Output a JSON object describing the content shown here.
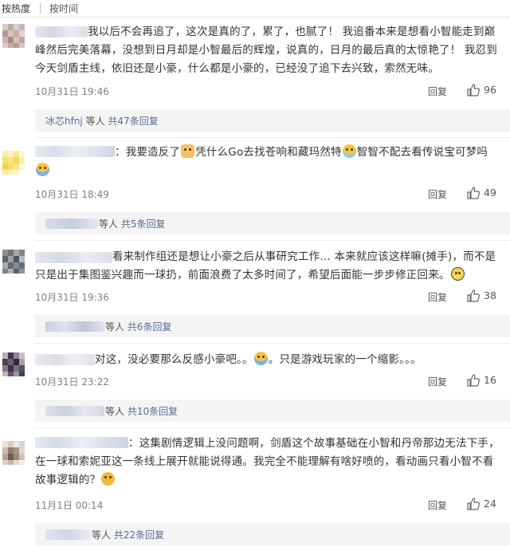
{
  "sort": {
    "hot": "按热度",
    "time": "按时间"
  },
  "ui": {
    "reply_label": "回复"
  },
  "comments": [
    {
      "name_tail": "",
      "text": "我以后不会再追了，这次是真的了，累了，也腻了！ 我追番本来是想看小智能走到巅峰然后完美落幕，没想到日月却是小智最后的辉煌，说真的，日月的最后真的太惊艳了！ 我忍到今天剑盾主线，依旧还是小豪，什么都是小豪的，已经没了追下去兴致，索然无味。",
      "time": "10月31日 19:46",
      "likes": "96",
      "reply_user": "冰芯hfnj",
      "reply_suffix": " 等人 ",
      "reply_count": "共47条回复"
    },
    {
      "name_tail": "：",
      "text_a": "我要造反了",
      "text_b": "凭什么Go去找苍响和藏玛然特",
      "text_c": "智智不配去看传说宝可梦吗",
      "time": "10月31日 18:49",
      "likes": "49",
      "reply_user": "",
      "reply_suffix": "等人 ",
      "reply_count": "共5条回复"
    },
    {
      "name_tail": "",
      "text": "看来制作组还是想让小豪之后从事研究工作… 本来就应该这样嘛(摊手)，而不是只是出于集图鉴兴趣而一球扔，前面浪费了太多时间了，希望后面能一步步修正回来。",
      "time": "10月31日 19:36",
      "likes": "38",
      "reply_user": "",
      "reply_suffix": "等人 ",
      "reply_count": "共6条回复"
    },
    {
      "name_tail": "",
      "text_a": "对这，没必要那么反感小豪吧。。",
      "text_b": "。只是游戏玩家的一个缩影。。。",
      "time": "10月31日 23:22",
      "likes": "16",
      "reply_user": "",
      "reply_suffix": "等人 ",
      "reply_count": "共10条回复"
    },
    {
      "name_tail": "：",
      "text": "这集剧情逻辑上没问题啊，剑盾这个故事基础在小智和丹帝那边无法下手，在一球和索妮亚这一条线上展开就能说得通。我完全不能理解有啥好喷的，看动画只看小智不看故事逻辑的？",
      "time": "11月1日 00:14",
      "likes": "24",
      "reply_user": "",
      "reply_suffix": "等人 ",
      "reply_count": "共22条回复"
    }
  ]
}
